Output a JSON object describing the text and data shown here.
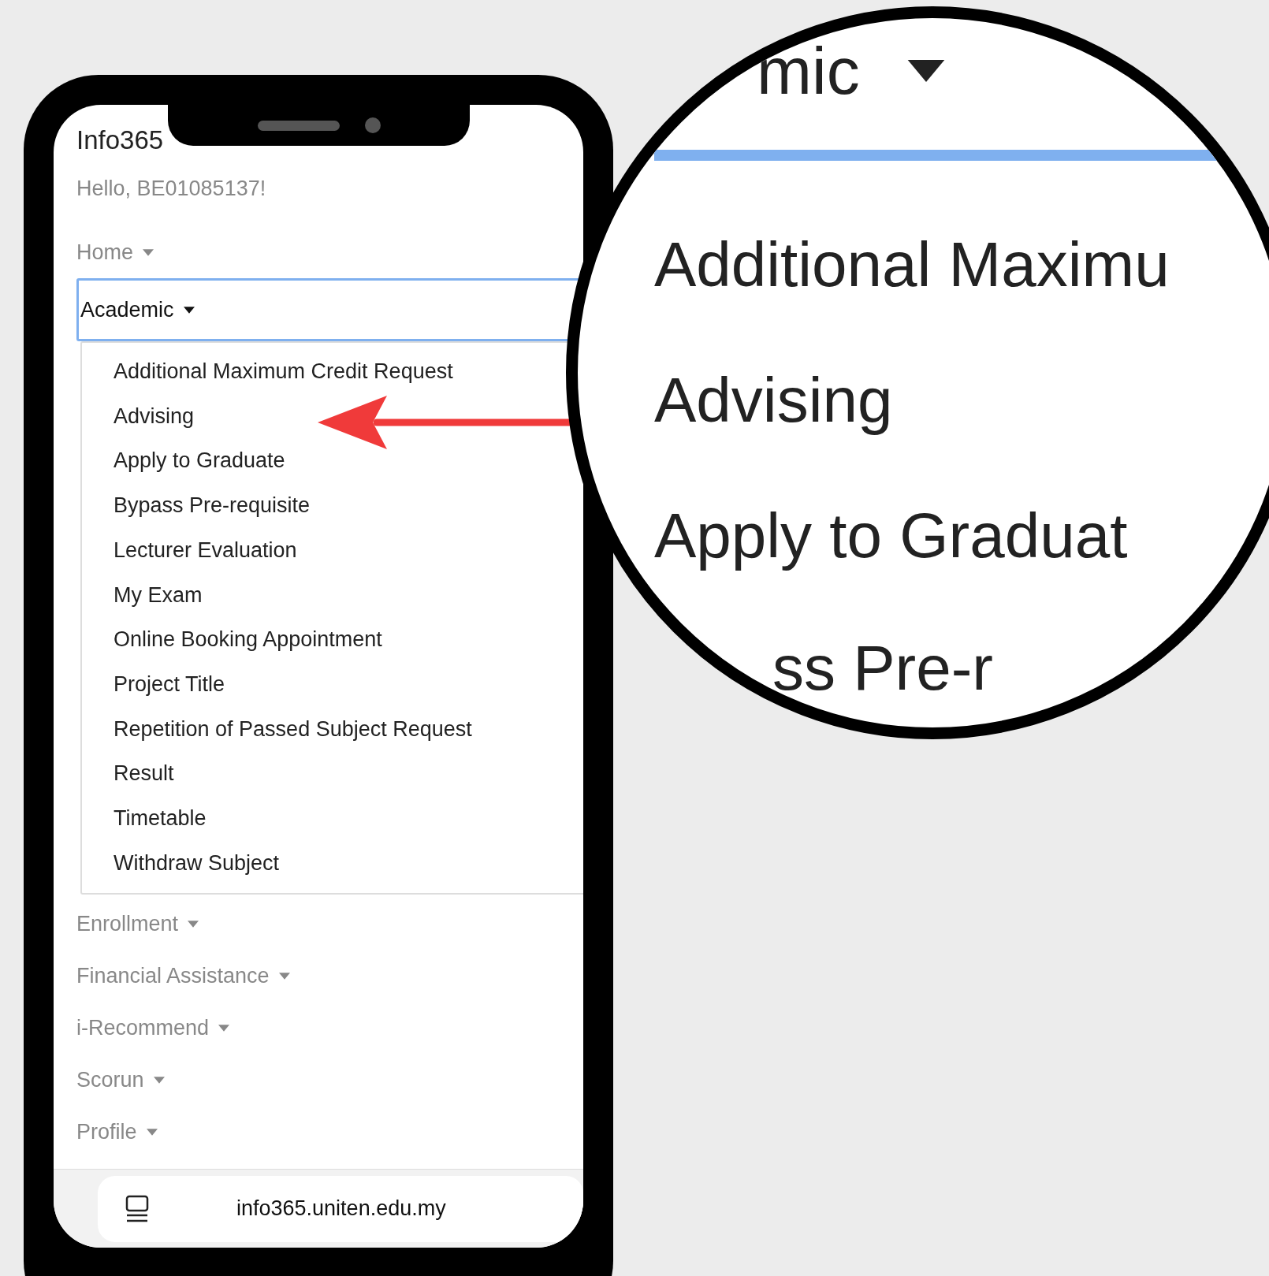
{
  "app": {
    "title": "Info365",
    "greeting": "Hello, BE01085137!"
  },
  "nav": [
    {
      "label": "Home",
      "expanded": false
    },
    {
      "label": "Academic",
      "expanded": true,
      "items": [
        "Additional Maximum Credit Request",
        "Advising",
        "Apply to Graduate",
        "Bypass Pre-requisite",
        "Lecturer Evaluation",
        "My Exam",
        "Online Booking Appointment",
        "Project Title",
        "Repetition of Passed Subject Request",
        "Result",
        "Timetable",
        "Withdraw Subject"
      ]
    },
    {
      "label": "Enrollment",
      "expanded": false
    },
    {
      "label": "Financial Assistance",
      "expanded": false
    },
    {
      "label": "i-Recommend",
      "expanded": false
    },
    {
      "label": "Scorun",
      "expanded": false
    },
    {
      "label": "Profile",
      "expanded": false
    }
  ],
  "url_bar": {
    "url": "info365.uniten.edu.my"
  },
  "magnifier": {
    "heading": "mic",
    "lines": [
      "Additional Maximu",
      "Advising",
      "Apply to Graduat",
      "ss Pre-r"
    ]
  }
}
